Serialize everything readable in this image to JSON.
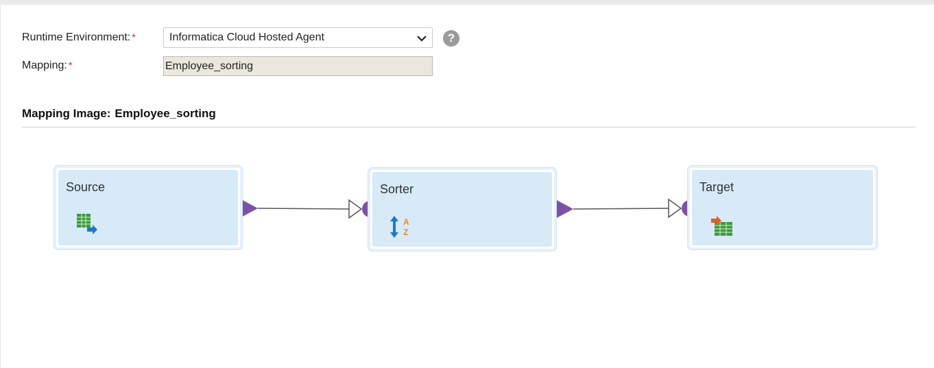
{
  "form": {
    "runtime_label": "Runtime Environment:",
    "runtime_required": "*",
    "runtime_value": "Informatica Cloud Hosted Agent",
    "help_glyph": "?",
    "mapping_label": "Mapping:",
    "mapping_required": "*",
    "mapping_value": "Employee_sorting"
  },
  "mapping_image": {
    "heading_prefix": "Mapping Image:",
    "heading_name": "Employee_sorting"
  },
  "nodes": [
    {
      "title": "Source",
      "icon": "source-table-icon"
    },
    {
      "title": "Sorter",
      "icon": "sort-az-icon"
    },
    {
      "title": "Target",
      "icon": "target-table-icon"
    }
  ],
  "colors": {
    "node_fill": "#d6eaf8",
    "port": "#7b52a6",
    "required": "#d9262b"
  }
}
